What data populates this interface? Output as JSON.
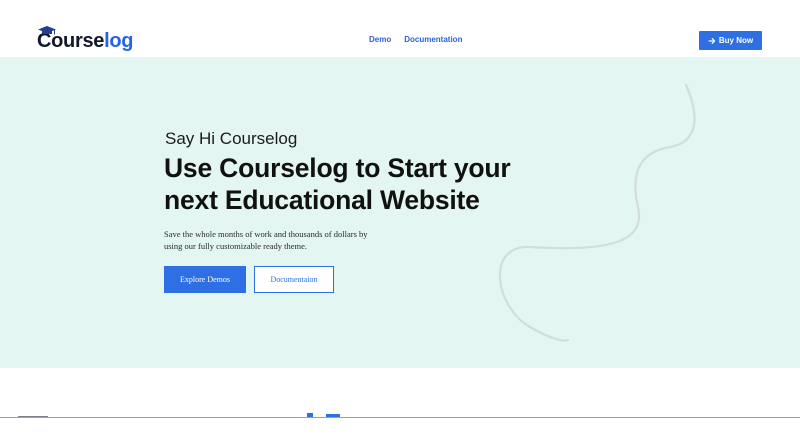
{
  "header": {
    "logo_prefix": "Course",
    "logo_accent": "log",
    "nav": [
      {
        "label": "Demo"
      },
      {
        "label": "Documentation"
      }
    ],
    "buy_button_label": "Buy Now",
    "buy_button_icon": "arrow-right-icon"
  },
  "hero": {
    "eyebrow": "Say Hi Courselog",
    "headline": "Use Courselog to Start your next Educational Website",
    "subtext": "Save the whole months of work and thousands of dollars by using our fully customizable ready theme.",
    "primary_button_label": "Explore Demos",
    "secondary_button_label": "Documentaion"
  },
  "colors": {
    "accent": "#2f6fe4",
    "hero_background": "#e3f6f1",
    "logo_dark": "#111827"
  }
}
